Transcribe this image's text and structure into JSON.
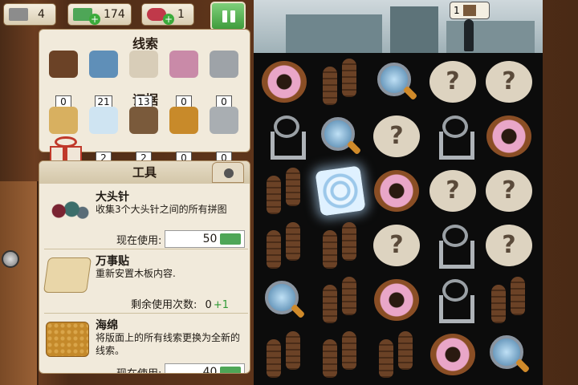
{
  "top_bar": {
    "tickets": "4",
    "cash": "174",
    "candy": "1"
  },
  "scene": {
    "badge_count": "1"
  },
  "clues": {
    "title": "线索",
    "items": [
      {
        "icon": "shoeprint-icon",
        "count": "0"
      },
      {
        "icon": "magnifier-icon",
        "count": "21"
      },
      {
        "icon": "question-bubble-icon",
        "count": "13"
      },
      {
        "icon": "donut-icon",
        "count": "0"
      },
      {
        "icon": "keys-icon",
        "count": "0"
      }
    ]
  },
  "evidence": {
    "title": "证据",
    "items": [
      {
        "icon": "map-icon",
        "count": "0"
      },
      {
        "icon": "fingerprint-icon",
        "count": "2"
      },
      {
        "icon": "mystery-frame-icon",
        "count": "2"
      },
      {
        "icon": "police-badge-icon",
        "count": "0"
      },
      {
        "icon": "brass-knuckles-icon",
        "count": "0"
      }
    ]
  },
  "tools": {
    "title": "工具",
    "items": [
      {
        "name": "大头针",
        "desc": "收集3个大头针之间的所有拼图",
        "cost_label": "现在使用:",
        "cost": "50"
      },
      {
        "name": "万事贴",
        "desc": "重新安置木板内容.",
        "uses_label": "剩余使用次数:",
        "uses": "0",
        "uses_bonus": "+1"
      },
      {
        "name": "海绵",
        "desc": "将版面上的所有线索更换为全新的线索。",
        "cost_label": "现在使用:",
        "cost": "40"
      }
    ]
  },
  "board": {
    "rows": [
      [
        "donut",
        "shoes",
        "mag",
        "q",
        "q"
      ],
      [
        "keys",
        "mag",
        "q",
        "keys",
        "donut"
      ],
      [
        "shoes",
        "print",
        "donut",
        "q",
        "q"
      ],
      [
        "shoes",
        "shoes",
        "q",
        "keys",
        "q"
      ],
      [
        "mag",
        "shoes",
        "donut",
        "keys",
        "shoes"
      ],
      [
        "shoes",
        "shoes",
        "shoes",
        "donut",
        "mag"
      ]
    ],
    "question_glyph": "?"
  }
}
